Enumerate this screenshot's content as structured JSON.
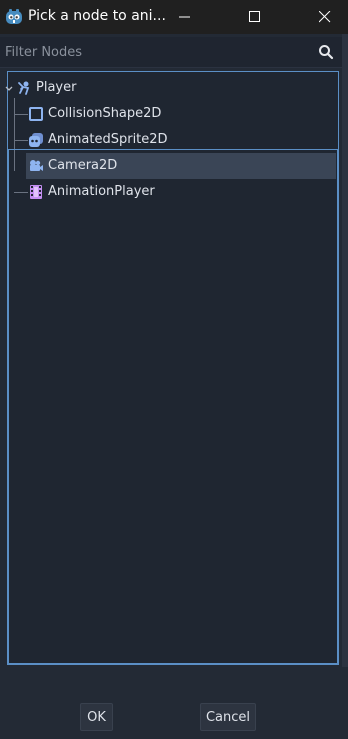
{
  "window": {
    "title": "Pick a node to ani...",
    "buttons": {
      "minimize": "minimize",
      "maximize": "maximize",
      "close": "close"
    }
  },
  "filter": {
    "placeholder": "Filter Nodes",
    "value": ""
  },
  "tree": {
    "root": {
      "label": "Player",
      "icon": "player-node-icon",
      "expanded": true
    },
    "children": [
      {
        "label": "CollisionShape2D",
        "icon": "collision-shape-icon",
        "selected": false
      },
      {
        "label": "AnimatedSprite2D",
        "icon": "animated-sprite-icon",
        "selected": false
      },
      {
        "label": "Camera2D",
        "icon": "camera-icon",
        "selected": true
      },
      {
        "label": "AnimationPlayer",
        "icon": "animation-player-icon",
        "selected": false
      }
    ]
  },
  "footer": {
    "ok_label": "OK",
    "cancel_label": "Cancel"
  },
  "colors": {
    "background": "#232a35",
    "selection": "#3a4556",
    "accent_border": "#5b8fc6",
    "node_icon_blue": "#8eb4f0",
    "animation_icon_purple": "#c38ef1"
  }
}
